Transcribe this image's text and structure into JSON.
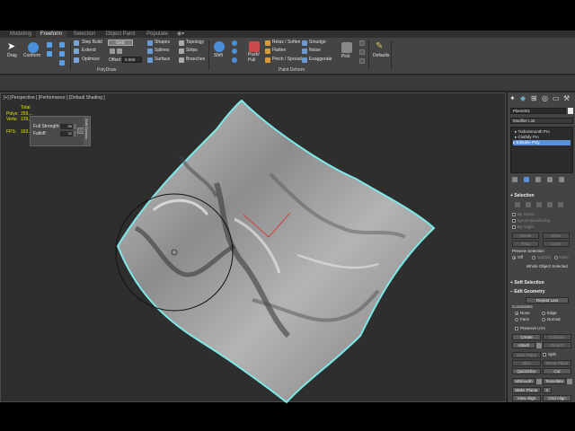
{
  "ribbon": {
    "tabs": [
      "Modeling",
      "Freeform",
      "Selection",
      "Object Paint",
      "Populate"
    ],
    "active_tab": "Freeform",
    "buttons": {
      "drag": "Drag",
      "conform": "Conform",
      "step_build": "Step Build",
      "extend": "Extend",
      "optimize": "Optimize",
      "grid": "Grid",
      "offset_label": "Offset",
      "offset_value": "0.000",
      "shapes": "Shapes",
      "splines": "Splines",
      "surface": "Surface",
      "topology": "Topology",
      "strips": "Strips",
      "branches": "Branches",
      "shift": "Shift",
      "push_pull": "Push/\nPull",
      "relax_soften": "Relax / Soften",
      "flatten": "Flatten",
      "pinch_spread": "Pinch / Spread",
      "smudge": "Smudge",
      "noise": "Noise",
      "exaggerate": "Exaggerate",
      "pick": "Pick",
      "defaults": "Defaults"
    },
    "group_labels": {
      "polydraw": "PolyDraw",
      "paint_deform": "Paint Deform"
    }
  },
  "viewport": {
    "label": "[+] [Perspective ] [Performance ] [Default Shading ]",
    "stats": {
      "total": "Total",
      "polys_label": "Polys:",
      "polys_value": "259,...",
      "verts_label": "Verts:",
      "verts_value": "129,...",
      "fps_label": "FPS:",
      "fps_value": "163..."
    },
    "brush_panel": {
      "full_strength_label": "Full Strength:",
      "full_strength_value": "85",
      "falloff_label": "Falloff:",
      "falloff_value": "32",
      "title": "Shift Options"
    }
  },
  "command_panel": {
    "object_name": "Plane001",
    "modifier_list": "Modifier List",
    "stack": [
      "TurboSmooth Pro",
      "Clothify Pro",
      "Editable Poly"
    ],
    "selection_rollout": "Selection",
    "selection_items": {
      "by_vertex": "By Vertex",
      "ignore_backfacing": "Ignore Backfacing",
      "by_angle": "By Angle:",
      "shrink": "Shrink",
      "grow": "Grow",
      "ring": "Ring",
      "loop": "Loop",
      "preview_selection": "Preview Selection",
      "off": "Off",
      "subobj": "SubObj",
      "multi": "Multi",
      "whole_object": "Whole Object Selected"
    },
    "soft_selection_rollout": "Soft Selection",
    "edit_geometry_rollout": "Edit Geometry",
    "edit_geometry": {
      "repeat_last": "Repeat Last",
      "constraints": "Constraints",
      "none": "None",
      "edge": "Edge",
      "face": "Face",
      "normal": "Normal",
      "preserve_uvs": "Preserve UVs",
      "create": "Create",
      "collapse": "Collapse",
      "attach": "Attach",
      "detach": "Detach",
      "slice_plane": "Slice Plane",
      "split": "Split",
      "slice": "Slice",
      "reset_plane": "Reset Plane",
      "quickslice": "QuickSlice",
      "cut": "Cut",
      "msmooth": "MSmooth",
      "tessellate": "Tessellate",
      "make_planar": "Make Planar",
      "x": "X",
      "view_align": "View Align",
      "grid_align": "Grid Align"
    }
  },
  "colors": {
    "ui_dark": "#2b2b2b",
    "ribbon": "#444444",
    "highlight": "#5b8fd6",
    "selection_outline": "#7fe8e8",
    "stats_yellow": "#e6e600",
    "cloth": "#9a9a9a"
  }
}
